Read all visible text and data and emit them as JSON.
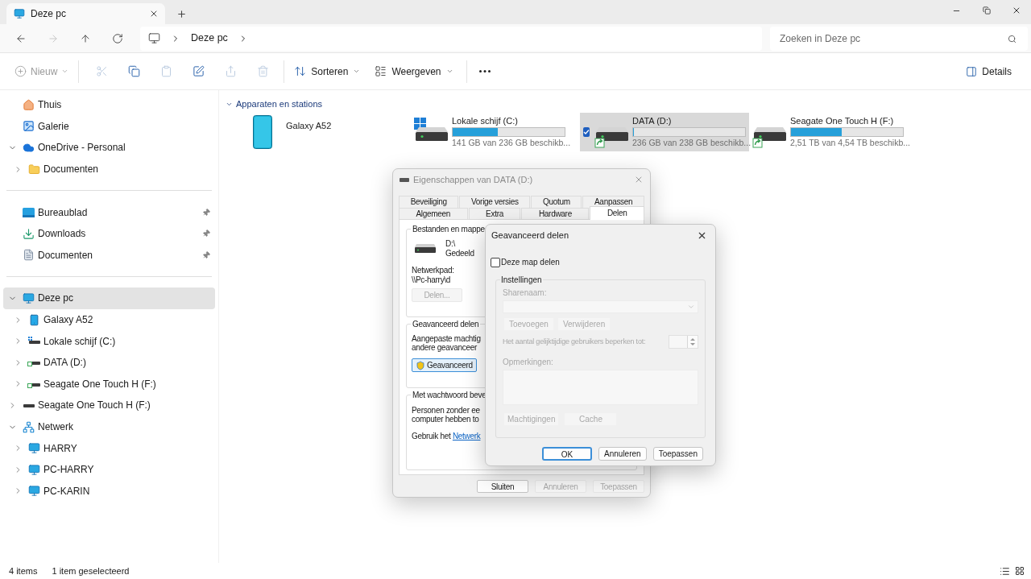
{
  "window": {
    "tab": {
      "title": "Deze pc"
    }
  },
  "navigation": [
    {
      "kind": "back",
      "disabled": false
    },
    {
      "kind": "forward",
      "disabled": true
    },
    {
      "kind": "up",
      "disabled": false
    },
    {
      "kind": "refresh",
      "disabled": false
    }
  ],
  "address_bar": {
    "segments": [
      "Deze pc"
    ]
  },
  "search": {
    "placeholder": "Zoeken in Deze pc"
  },
  "toolbar": {
    "new": {
      "label": "Nieuw",
      "disabled": true
    },
    "actions": [
      {
        "kind": "cut",
        "disabled": true
      },
      {
        "kind": "copy",
        "disabled": false
      },
      {
        "kind": "paste",
        "disabled": true
      },
      {
        "kind": "rename",
        "disabled": false
      },
      {
        "kind": "share",
        "disabled": true
      },
      {
        "kind": "delete",
        "disabled": true
      }
    ],
    "menus": [
      {
        "kind": "sort",
        "label": "Sorteren"
      },
      {
        "kind": "view",
        "label": "Weergeven"
      }
    ],
    "details": {
      "label": "Details"
    }
  },
  "sidebar": {
    "sections": [
      {
        "items": [
          {
            "kind": "home",
            "label": "Thuis",
            "selected": false
          },
          {
            "kind": "gallery",
            "label": "Galerie",
            "selected": false
          },
          {
            "kind": "cloud",
            "label": "OneDrive - Personal",
            "selected": false,
            "expanded": true,
            "children": [
              {
                "kind": "folder",
                "label": "Documenten",
                "selected": false,
                "expanded": false
              }
            ]
          }
        ]
      },
      {
        "items": [
          {
            "kind": "desktop",
            "label": "Bureaublad",
            "selected": false,
            "pinned": true
          },
          {
            "kind": "download",
            "label": "Downloads",
            "selected": false,
            "pinned": true
          },
          {
            "kind": "document",
            "label": "Documenten",
            "selected": false,
            "pinned": true
          }
        ]
      },
      {
        "items": [
          {
            "kind": "pc",
            "label": "Deze pc",
            "selected": true,
            "expanded": true,
            "children": [
              {
                "kind": "phone",
                "label": "Galaxy A52",
                "selected": false,
                "expanded": false
              },
              {
                "kind": "system_drive",
                "label": "Lokale schijf (C:)",
                "selected": false,
                "expanded": false
              },
              {
                "kind": "shared_drive",
                "label": "DATA (D:)",
                "selected": false,
                "expanded": false
              },
              {
                "kind": "shared_drive",
                "label": "Seagate One Touch H (F:)",
                "selected": false,
                "expanded": false
              }
            ]
          },
          {
            "kind": "usb_drive",
            "label": "Seagate One Touch H (F:)",
            "selected": false,
            "expanded": false
          },
          {
            "kind": "network",
            "label": "Netwerk",
            "selected": false,
            "expanded": true,
            "children": [
              {
                "kind": "computer",
                "label": "HARRY",
                "selected": false,
                "expanded": false
              },
              {
                "kind": "computer",
                "label": "PC-HARRY",
                "selected": false,
                "expanded": false
              },
              {
                "kind": "computer",
                "label": "PC-KARIN",
                "selected": false,
                "expanded": false
              }
            ]
          }
        ]
      }
    ]
  },
  "content": {
    "group": {
      "title": "Apparaten en stations",
      "expanded": true
    },
    "devices": [
      {
        "kind": "phone",
        "name": "Galaxy A52",
        "selected": false
      },
      {
        "kind": "drive",
        "name": "Lokale schijf (C:)",
        "system": true,
        "shared": false,
        "level": 0.4,
        "reading": "141 GB van 236 GB beschikb...",
        "selected": false
      },
      {
        "kind": "drive",
        "name": "DATA (D:)",
        "system": false,
        "shared": true,
        "level": 0.01,
        "reading": "236 GB van 238 GB beschikb...",
        "selected": true
      },
      {
        "kind": "drive",
        "name": "Seagate One Touch H (F:)",
        "system": false,
        "shared": true,
        "level": 0.45,
        "reading": "2,51 TB van 4,54 TB beschikb...",
        "selected": false
      }
    ]
  },
  "status_bar": {
    "items": [
      "4 items",
      "1 item geselecteerd"
    ]
  },
  "properties_dialog": {
    "title": "Eigenschappen van DATA (D:)",
    "tab_rows": [
      [
        {
          "label": "Beveiliging",
          "selected": false
        },
        {
          "label": "Vorige versies",
          "selected": false
        },
        {
          "label": "Quotum",
          "selected": false
        },
        {
          "label": "Aanpassen",
          "selected": false
        }
      ],
      [
        {
          "label": "Algemeen",
          "selected": false
        },
        {
          "label": "Extra",
          "selected": false
        },
        {
          "label": "Hardware",
          "selected": false
        },
        {
          "label": "Delen",
          "selected": true
        }
      ]
    ],
    "file_sharing": {
      "legend": "Bestanden en mappe",
      "drive": "D:\\",
      "status": "Gedeeld",
      "path_label": "Netwerkpad:",
      "path": "\\\\Pc-harry\\d",
      "button": {
        "label": "Delen...",
        "disabled": true
      }
    },
    "advanced_sharing": {
      "legend": "Geavanceerd delen",
      "lines": [
        "Aangepaste machtig",
        "andere geavanceer"
      ],
      "button": {
        "label": "Geavanceerd",
        "disabled": false
      }
    },
    "password": {
      "legend": "Met wachtwoord beve",
      "lines": [
        "Personen zonder ee",
        "computer hebben to"
      ],
      "text": "Gebruik het",
      "link": "Netwerk"
    },
    "buttons": [
      {
        "label": "Sluiten",
        "disabled": false
      },
      {
        "label": "Annuleren",
        "disabled": true
      },
      {
        "label": "Toepassen",
        "disabled": true
      }
    ]
  },
  "sharing_dialog": {
    "title": "Geavanceerd delen",
    "share_checkbox": {
      "label": "Deze map delen",
      "checked": false
    },
    "settings": {
      "legend": "Instellingen",
      "disabled": true,
      "share_name_label": "Sharenaam:",
      "add_button": "Toevoegen",
      "remove_button": "Verwijderen",
      "limit_label": "Het aantal gelijktijdige gebruikers beperken tot:",
      "comments_label": "Opmerkingen:",
      "permissions_button": "Machtigingen",
      "cache_button": "Cache"
    },
    "buttons": [
      {
        "label": "OK",
        "default": true
      },
      {
        "label": "Annuleren",
        "default": false
      },
      {
        "label": "Toepassen",
        "default": false
      }
    ]
  }
}
